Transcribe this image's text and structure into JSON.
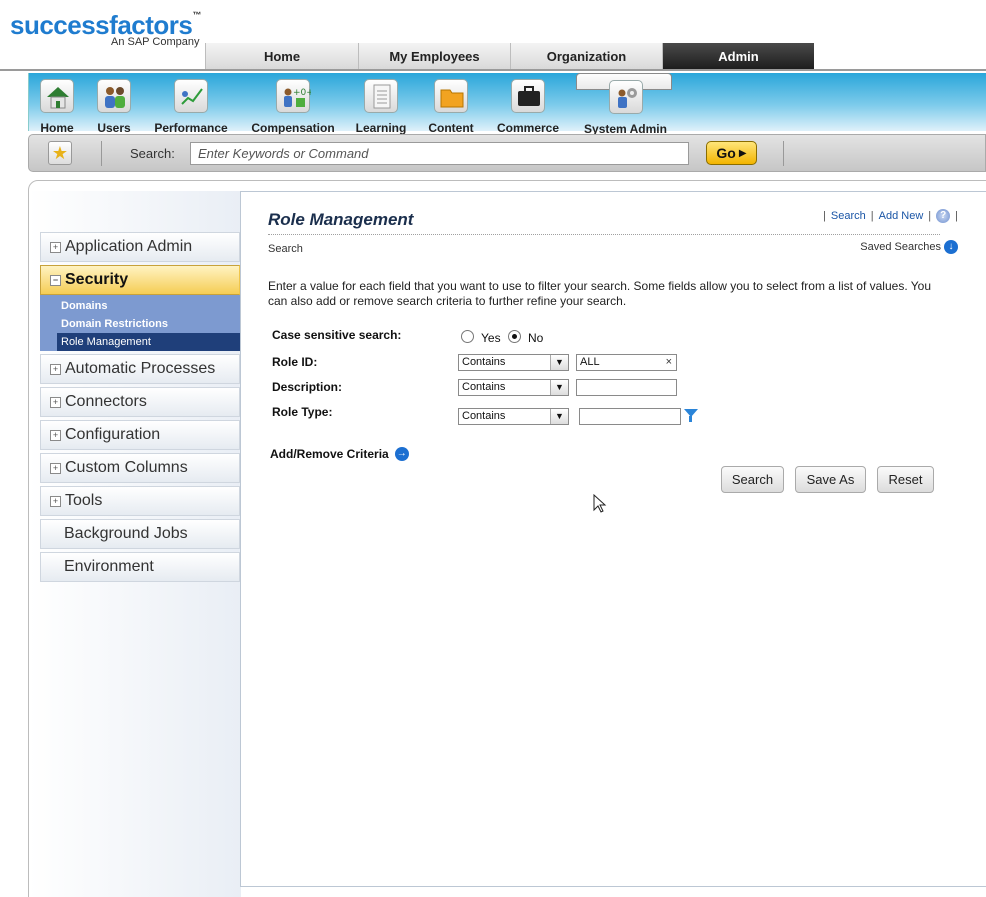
{
  "brand": {
    "logo_part1": "success",
    "logo_part2": "factors",
    "tagline": "An SAP Company"
  },
  "top_tabs": [
    "Home",
    "My Employees",
    "Organization",
    "Admin"
  ],
  "modules": [
    "Home",
    "Users",
    "Performance",
    "Compensation",
    "Learning",
    "Content",
    "Commerce",
    "System Admin"
  ],
  "toolbar": {
    "search_label": "Search:",
    "search_placeholder": "Enter Keywords or Command",
    "go_label": "Go"
  },
  "left_nav": {
    "items": [
      "Application Admin",
      "Security",
      "Automatic Processes",
      "Connectors",
      "Configuration",
      "Custom Columns",
      "Tools",
      "Background Jobs",
      "Environment"
    ],
    "security_sub": [
      "Domains",
      "Domain Restrictions",
      "Role Management"
    ]
  },
  "panel": {
    "title": "Role Management",
    "links": {
      "search": "Search",
      "add_new": "Add New",
      "help": "?"
    },
    "subheading": "Search",
    "saved_searches": "Saved Searches",
    "instructions": "Enter a value for each field that you want to use to filter your search. Some fields allow you to select from a list of values. You can also add or remove search criteria to further refine your search."
  },
  "form": {
    "case_label": "Case sensitive search:",
    "yes": "Yes",
    "no": "No",
    "case_selected": "No",
    "role_id_label": "Role ID:",
    "role_id_op": "Contains",
    "role_id_value": "ALL",
    "description_label": "Description:",
    "description_op": "Contains",
    "description_value": "",
    "role_type_label": "Role Type:",
    "role_type_op": "Contains",
    "role_type_value": "",
    "add_remove": "Add/Remove Criteria",
    "buttons": {
      "search": "Search",
      "save_as": "Save As",
      "reset": "Reset"
    }
  },
  "colors": {
    "admin_tab": "#1c1c1c",
    "module_bar": "#2aa6da",
    "security_highlight": "#f5cd55",
    "subnav": "#7d9ad0",
    "go_button": "#f2b400",
    "link": "#1a55a6"
  }
}
